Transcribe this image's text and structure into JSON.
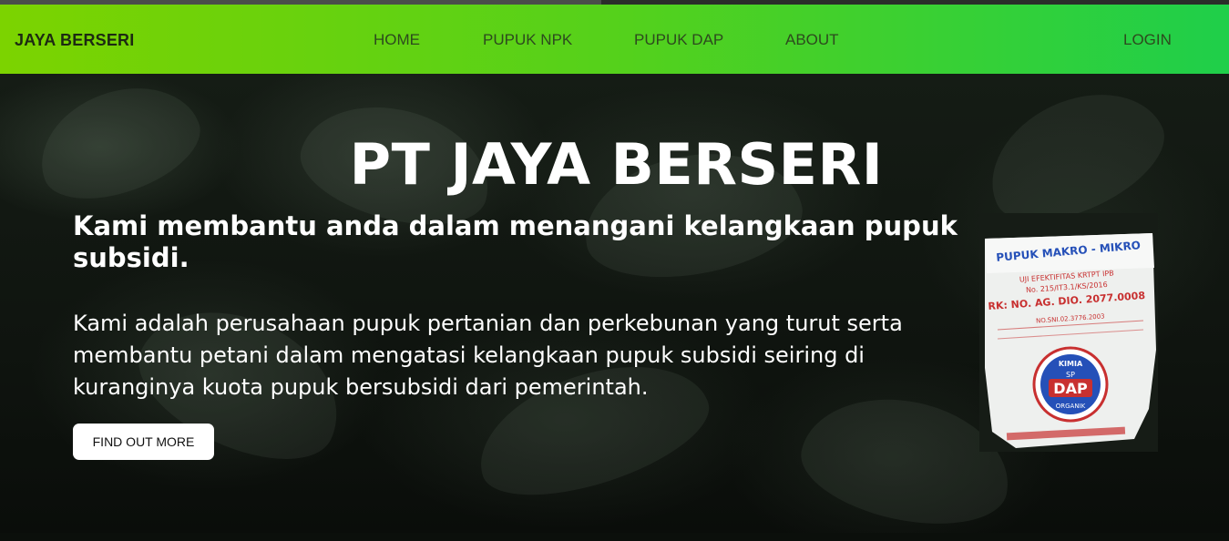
{
  "nav": {
    "brand": "JAYA BERSERI",
    "links": [
      "HOME",
      "PUPUK NPK",
      "PUPUK DAP",
      "ABOUT"
    ],
    "login": "LOGIN"
  },
  "hero": {
    "title": "PT JAYA BERSERI",
    "subtitle": "Kami membantu anda dalam menangani kelangkaan pupuk subsidi.",
    "description": "Kami adalah perusahaan pupuk pertanian dan perkebunan yang turut serta membantu petani dalam mengatasi kelangkaan pupuk subsidi seiring di kuranginya kuota pupuk bersubsidi dari pemerintah.",
    "cta": "FIND OUT MORE"
  },
  "product_image": {
    "line1": "PUPUK MAKRO - MIKRO",
    "line2": "UJI EFEKTIFITAS KRTPT IPB",
    "line3": "No. 215/IT3.1/KS/2016",
    "line4": "RK: NO. AG. DIO. 2077.0008",
    "line5": "NO.SNI.02.3776.2003",
    "badge_top": "KIMIA",
    "badge_sp": "SP",
    "badge_main": "DAP",
    "badge_bottom": "ORGANIK"
  },
  "colors": {
    "nav_gradient_start": "#7cd300",
    "nav_gradient_end": "#1fcf4a",
    "hero_bg": "#0f140f",
    "text_light": "#ffffff"
  }
}
